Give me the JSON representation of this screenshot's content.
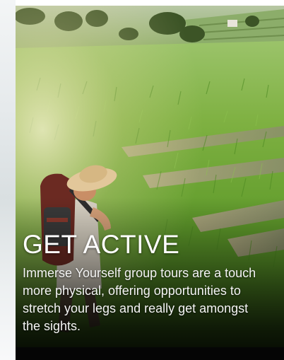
{
  "card": {
    "title": "GET ACTIVE",
    "description": "Immerse Yourself group tours are a touch more physical, offering opportunities to stretch your legs and really get amongst the sights.",
    "image_alt": "Hiker in a straw hat walking through green rice terraces"
  },
  "colors": {
    "text": "#ffffff",
    "grass": "#6aa22e",
    "shadow_overlay": "#000000"
  }
}
